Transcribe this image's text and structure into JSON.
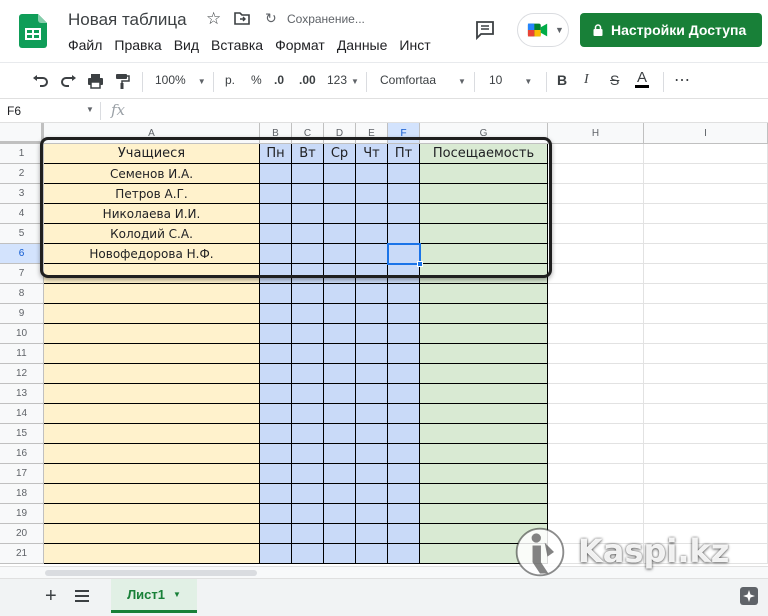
{
  "header": {
    "doc_title": "Новая таблица",
    "status": "Сохранение...",
    "share_label": "Настройки Доступа",
    "menu": [
      "Файл",
      "Правка",
      "Вид",
      "Вставка",
      "Формат",
      "Данные",
      "Инст"
    ]
  },
  "toolbar": {
    "zoom": "100%",
    "currency": "р.",
    "percent": "%",
    "dec_decrease": ".0",
    "dec_increase": ".00",
    "format_more": "123",
    "font": "Comfortaa",
    "font_size": "10",
    "bold": "B",
    "italic": "I",
    "strike": "S",
    "text_color": "A",
    "more": "⋯"
  },
  "formula_bar": {
    "cell_ref": "F6",
    "fx": "fx"
  },
  "grid": {
    "columns": [
      "A",
      "B",
      "C",
      "D",
      "E",
      "F",
      "G",
      "H",
      "I"
    ],
    "rows": [
      "1",
      "2",
      "3",
      "4",
      "5",
      "6",
      "7",
      "8",
      "9",
      "10",
      "11",
      "12",
      "13",
      "14",
      "15",
      "16",
      "17",
      "18",
      "19",
      "20",
      "21"
    ],
    "selected_column": "F",
    "selected_row": "6",
    "header_row": [
      "Учащиеся",
      "Пн",
      "Вт",
      "Ср",
      "Чт",
      "Пт",
      "Посещаемость"
    ],
    "students": [
      "Семенов И.А.",
      "Петров А.Г.",
      "Николаева И.И.",
      "Колодий С.А.",
      "Новофедорова Н.Ф."
    ],
    "colors": {
      "names": "#fff2cc",
      "days": "#c9daf8",
      "attendance": "#d9ead3"
    }
  },
  "bottom": {
    "sheet_name": "Лист1"
  },
  "watermark": {
    "text": "Kaspi.kz"
  },
  "colors": {
    "accent": "#188038",
    "selection": "#1a73e8"
  }
}
